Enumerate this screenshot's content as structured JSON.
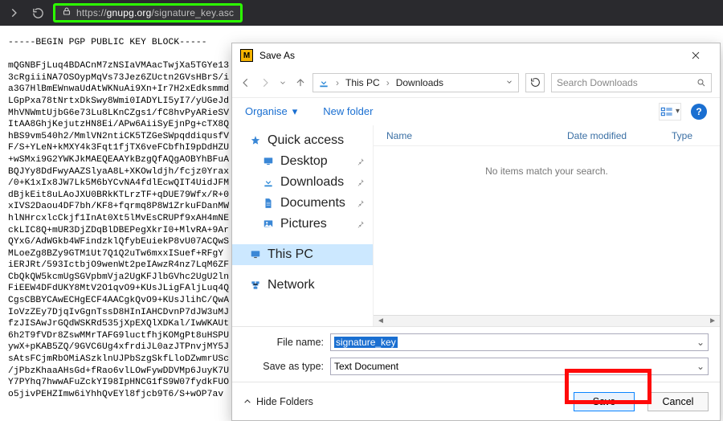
{
  "browser": {
    "url_prefix": "https://",
    "url_host": "gnupg.org",
    "url_path": "/signature_key.asc"
  },
  "pgp": {
    "begin": "-----BEGIN PGP PUBLIC KEY BLOCK-----",
    "lines": [
      "mQGNBFjLuq4BDACnM7zNSIaVMAacTwjXa5TGYe13",
      "3cRgiiiNA7OSOypMqVs73Jez6ZUctn2GVsHBrS/i",
      "a3G7HlBmEWnwaUdAtWKNuAi9Xn+Ir7H2xEdksmmd",
      "LGpPxa78tNrtxDkSwy8Wmi0IADYLI5yI7/yUGeJd",
      "MhVNWmtUjbG6e73Lu8LKnCZgs1/fC8hvPyARieSV",
      "ItAA8GhjKejutzHN8Ei/APw6AiiSyEjnPg+cTX8Q",
      "hBS9vm540h2/MmlVN2ntiCK5TZGeSWpqddiqusfV",
      "F/S+YLeN+kMXY4k3Fqt1fjTX6veFCbfhI9pDdHZU",
      "+wSMxi9G2YWKJkMAEQEAAYkBzgQfAQgAOBYhBFuA",
      "BQJYy8DdFwyAAZSlyaA8L+XKOwldjh/fcjz0Yrax",
      "/0+K1xIx8JW7Lk5M6bYCvNA4fdlEcwQIT4UidJFM",
      "dBjkEit8uLAoJXU0BRkKTLrzTF+qDUE79Wfx/R+0",
      "xIVS2Daou4DF7bh/KF8+fqrmq8P8W1ZrkuFDanMW",
      "hlNHrcxlcCkjf1InAt0Xt5lMvEsCRUPf9xAH4mNE",
      "ckLIC8Q+mUR3DjZDqBlDBEPegXkrI0+MlvRA+9Ar",
      "QYxG/AdWGkb4WFindzklQfybEuiekP8vU07ACQwS",
      "MLoeZg8BZy9GTM1Ut7Q1Q2uTw6mxxISuef+RFgY",
      "iERJRt/593IctbjO9wenWt2peIAwzR4nz7LqM6ZF",
      "CbQkQW5kcmUgSGVpbmVja2UgKFJlbGVhc2UgU2ln",
      "FiEEW4DFdUKY8MtV2O1qvO9+KUsJLigFAljLuq4Q",
      "CgsCBBYCAwECHgECF4AACgkQvO9+KUsJlihC/QwA",
      "IoVzZEy7DjqIvGgnTssD8HInIAHCDvnP7dJW3uMJ",
      "fzJISAwJrGQdWSKRd535jXpEXQlXDKal/IwWKAUt",
      "6h2T9fVDr8ZswMMrTAFG9luctfhjKOMgPt8uHSPU",
      "ywX+pKAB5ZQ/9GVC6Ug4xfrdiJL0azJTPnvjMY5J",
      "sAtsFCjmRbOMiASzklnUJPbSzgSkfLloDZwmrUSc",
      "/jPbzKhaaAHsGd+fRao6vlLOwFywDDVMp6JuyK7U",
      "Y7PYhq7hwwAFuZckYI98IpHNCG1fS9W07fydkFUO",
      "o5jivPEHZImw6iYhhQvEYl8fjcb9T6/S+wOP7av"
    ]
  },
  "dialog": {
    "title": "Save As",
    "path": {
      "seg1": "This PC",
      "seg2": "Downloads"
    },
    "search_placeholder": "Search Downloads",
    "toolbar": {
      "organise": "Organise",
      "newfolder": "New folder"
    },
    "nav": {
      "quick": "Quick access",
      "desktop": "Desktop",
      "downloads": "Downloads",
      "documents": "Documents",
      "pictures": "Pictures",
      "thispc": "This PC",
      "network": "Network"
    },
    "cols": {
      "name": "Name",
      "date": "Date modified",
      "type": "Type"
    },
    "empty": "No items match your search.",
    "filename_label": "File name:",
    "filename_value": "signature_key",
    "savetype_label": "Save as type:",
    "savetype_value": "Text Document",
    "hidefolders": "Hide Folders",
    "save": "Save",
    "cancel": "Cancel"
  }
}
